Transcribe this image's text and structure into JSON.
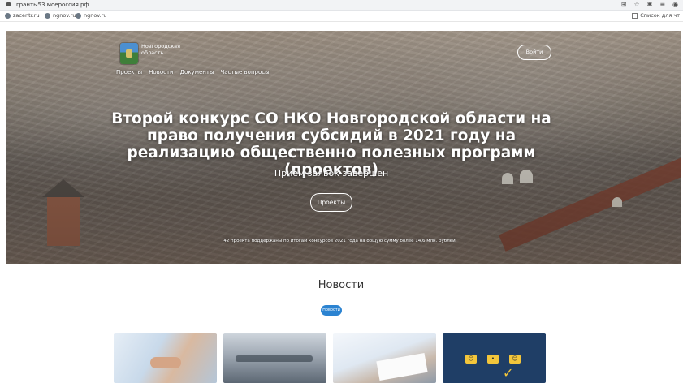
{
  "browser": {
    "url": "гранты53.моероссия.рф",
    "bookmarks": [
      "zacentr.ru",
      "ngnov.ru",
      "ngnov.ru"
    ],
    "reading_list": "Список для чт",
    "action_icons": [
      "translate-icon",
      "star-icon",
      "extensions-icon",
      "playlist-icon",
      "profile-icon"
    ]
  },
  "site": {
    "name": "Новгородская область",
    "nav": [
      "Проекты",
      "Новости",
      "Документы",
      "Частые вопросы"
    ],
    "login_label": "Войти"
  },
  "hero": {
    "headline": "Второй конкурс СО НКО Новгородской области на право получения субсидий в 2021 году на реализацию общественно полезных программ (проектов)",
    "status": "Приём заявок завершен",
    "projects_button": "Проекты",
    "note": "42 проекта поддержаны по итогам конкурсов 2021 года на общую сумму более 14,6 млн. рублей"
  },
  "news": {
    "title": "Новости",
    "tag": "Новости",
    "cards": [
      {
        "icon": "handshake-image"
      },
      {
        "icon": "meeting-image"
      },
      {
        "icon": "signing-document-image"
      },
      {
        "icon": "feedback-faces-image"
      }
    ]
  },
  "colors": {
    "accent": "#2b83d1",
    "wall": "#8d4b3a"
  }
}
